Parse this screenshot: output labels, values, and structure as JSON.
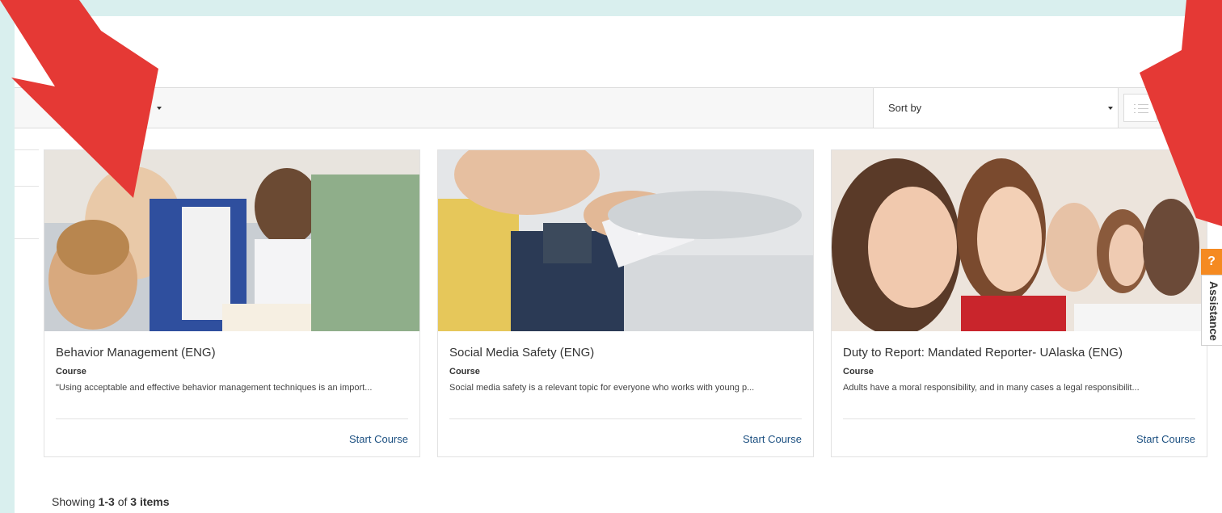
{
  "toolbar": {
    "sort_label": "Sort by"
  },
  "cards": [
    {
      "title": "Behavior Management (ENG)",
      "type": "Course",
      "description": "\"Using acceptable and effective behavior management techniques is an import...",
      "action": "Start Course"
    },
    {
      "title": "Social Media Safety (ENG)",
      "type": "Course",
      "description": "Social media safety is a relevant topic for everyone who works with young p...",
      "action": "Start Course"
    },
    {
      "title": "Duty to Report: Mandated Reporter- UAlaska (ENG)",
      "type": "Course",
      "description": "Adults have a moral responsibility, and in many cases a legal responsibilit...",
      "action": "Start Course"
    }
  ],
  "pagination": {
    "prefix": "Showing",
    "range": "1-3",
    "of": "of",
    "total": "3 items"
  },
  "assistance": {
    "icon_glyph": "?",
    "label": "Assistance",
    "color": "#f58a21"
  },
  "colors": {
    "link": "#1b4f80",
    "background": "#d9efee",
    "annotation_arrow": "#e53935"
  }
}
